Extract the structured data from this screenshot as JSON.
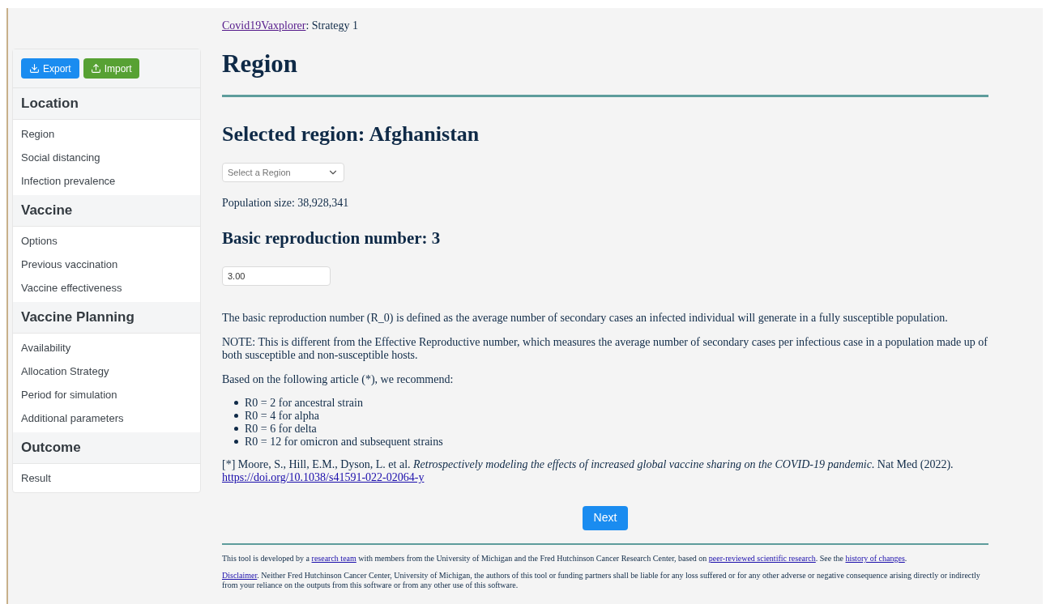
{
  "sidebar": {
    "buttons": [
      {
        "label": "Export",
        "kind": "export"
      },
      {
        "label": "Import",
        "kind": "import"
      }
    ],
    "sections": [
      {
        "title": "Location",
        "items": [
          "Region",
          "Social distancing",
          "Infection prevalence"
        ]
      },
      {
        "title": "Vaccine",
        "items": [
          "Options",
          "Previous vaccination",
          "Vaccine effectiveness"
        ]
      },
      {
        "title": "Vaccine Planning",
        "items": [
          "Availability",
          "Allocation Strategy",
          "Period for simulation",
          "Additional parameters"
        ]
      },
      {
        "title": "Outcome",
        "items": [
          "Result"
        ]
      }
    ]
  },
  "breadcrumb": {
    "link": "Covid19Vaxplorer",
    "rest": ": Strategy 1"
  },
  "title": "Region",
  "selected_region": "Selected region: Afghanistan",
  "region_select": {
    "placeholder": "Select a Region"
  },
  "population": "Population size: 38,928,341",
  "r0_heading": "Basic reproduction number: 3",
  "r0_input": {
    "value": "3.00"
  },
  "paragraphs": [
    "The basic reproduction number (R_0) is defined as the average number of secondary cases an infected individual will generate in a fully susceptible population.",
    "NOTE: This is different from the Effective Reproductive number, which measures the average number of secondary cases per infectious case in a population made up of both susceptible and non-susceptible hosts.",
    "Based on the following article (*), we recommend:"
  ],
  "recommendations": [
    "R0 = 2 for ancestral strain",
    "R0 = 4 for alpha",
    "R0 = 6 for delta",
    "R0 = 12 for omicron and subsequent strains"
  ],
  "reference": {
    "text": "[*] Moore, S., Hill, E.M., Dyson, L. et al. *Retrospectively modeling the effects of increased global vaccine sharing on the COVID-19 pandemic*. Nat Med (2022).",
    "link": "https://doi.org/10.1038/s41591-022-02064-y"
  },
  "next_button": "Next",
  "footer": [
    [
      {
        "text": "This tool is developed by a ",
        "link": false
      },
      {
        "text": "research team",
        "link": true
      },
      {
        "text": " with members from the University of Michigan and the Fred Hutchinson Cancer Research Center, based on ",
        "link": false
      },
      {
        "text": "peer-reviewed scientific research",
        "link": true
      },
      {
        "text": ". See the ",
        "link": false
      },
      {
        "text": "history of changes",
        "link": true
      },
      {
        "text": ".",
        "link": false
      }
    ],
    [
      {
        "text": "Disclaimer",
        "link": true
      },
      {
        "text": ". Neither Fred Hutchinson Cancer Center, University of Michigan, the authors of this tool or funding partners shall be liable for any loss suffered or for any other adverse or negative consequence arising directly or indirectly from your reliance on the outputs from this software or from any other use of this software.",
        "link": false
      }
    ]
  ]
}
